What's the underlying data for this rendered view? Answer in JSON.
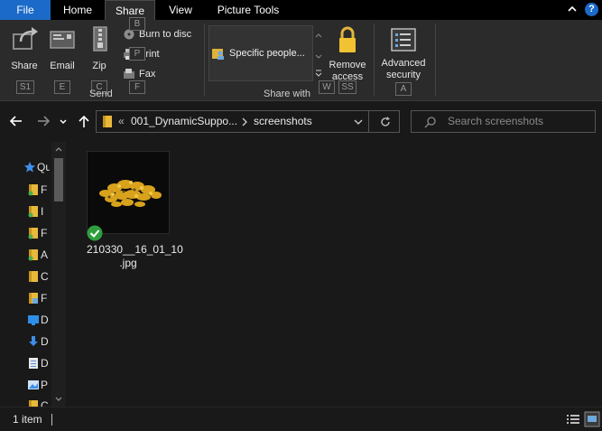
{
  "ribbon_tabs": {
    "file": "File",
    "home": "Home",
    "share": "Share",
    "view": "View",
    "picture_tools": "Picture Tools"
  },
  "ribbon": {
    "share_label": "Share",
    "email_label": "Email",
    "zip_label": "Zip",
    "burn_label": "Burn to disc",
    "print_label": "Print",
    "fax_label": "Fax",
    "send_group": "Send",
    "gallery_item": "Specific people...",
    "remove_access_line1": "Remove",
    "remove_access_line2": "access",
    "share_with_group": "Share with",
    "advanced_line1": "Advanced",
    "advanced_line2": "security",
    "keytips": {
      "share": "S1",
      "email": "E",
      "zip": "C",
      "burn": "B",
      "print": "P",
      "fax": "F",
      "share_with": "W",
      "remove": "SS",
      "advanced": "A"
    }
  },
  "address": {
    "overflow": "«",
    "folder1": "001_DynamicSuppo...",
    "folder2": "screenshots"
  },
  "search": {
    "placeholder": "Search screenshots"
  },
  "nav_pane": {
    "items": [
      {
        "label": "Qu",
        "icon": "star-icon"
      },
      {
        "label": "F",
        "icon": "folder-pinned-icon"
      },
      {
        "label": "I",
        "icon": "folder-synced-icon"
      },
      {
        "label": "F",
        "icon": "folder-pinned-icon"
      },
      {
        "label": "A",
        "icon": "folder-synced-icon"
      },
      {
        "label": "C",
        "icon": "folder-icon"
      },
      {
        "label": "F",
        "icon": "folder-pinned-icon"
      },
      {
        "label": "D",
        "icon": "desktop-icon"
      },
      {
        "label": "D",
        "icon": "download-icon"
      },
      {
        "label": "D",
        "icon": "document-icon"
      },
      {
        "label": "P",
        "icon": "pictures-icon"
      },
      {
        "label": "C",
        "icon": "folder-icon"
      }
    ]
  },
  "files": [
    {
      "name_line1": "210330__16_01_10",
      "name_line2": ".jpg",
      "status": "synced"
    }
  ],
  "status": {
    "item_count": "1 item"
  },
  "colors": {
    "accent": "#1b6ac9",
    "background": "#191919",
    "ribbon": "#2b2b2b"
  }
}
